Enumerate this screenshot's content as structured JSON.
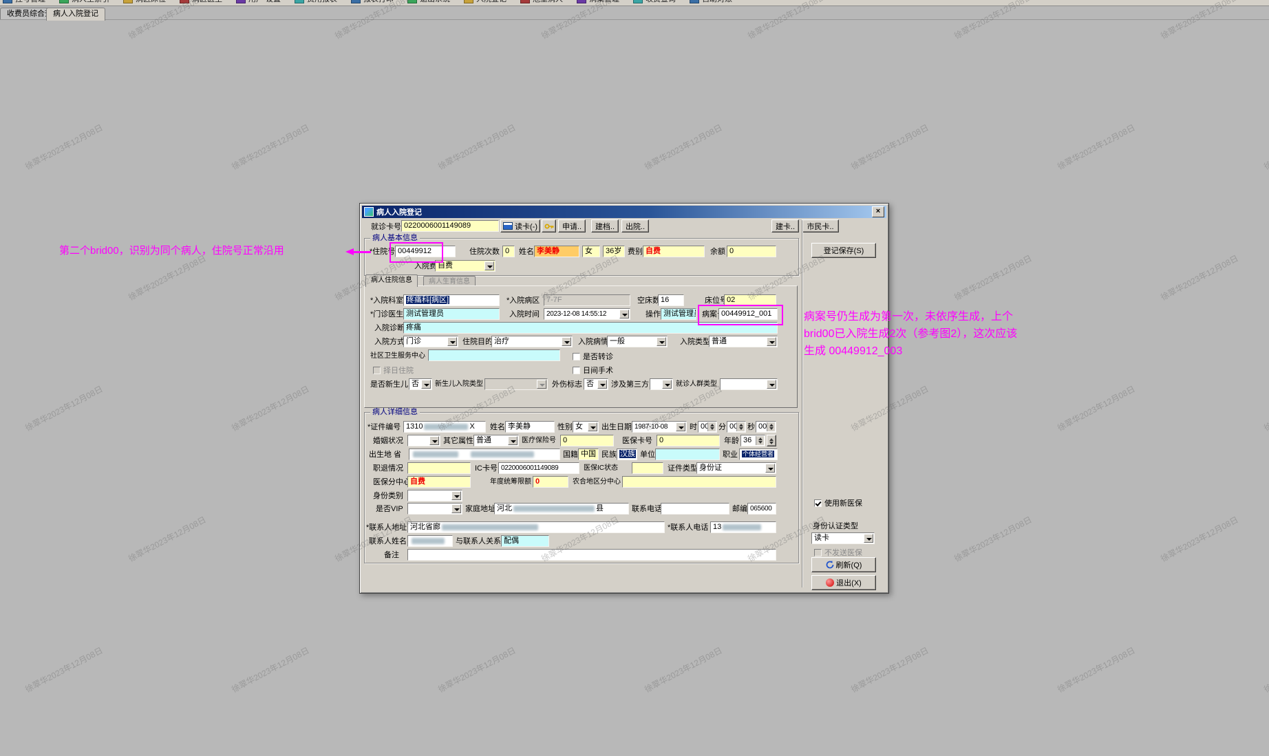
{
  "watermark": {
    "text": "徐翠华2023年12月08日"
  },
  "top_toolbar": {
    "items": [
      {
        "label": "挂号管理"
      },
      {
        "label": "病人主索引"
      },
      {
        "label": "病区床位"
      },
      {
        "label": "病区医生"
      },
      {
        "label": "用户 设置"
      },
      {
        "label": "费用报表"
      },
      {
        "label": "报表打印"
      },
      {
        "label": "退出系统"
      },
      {
        "label": "入院登记"
      },
      {
        "label": "危重病人"
      },
      {
        "label": "病案管理"
      },
      {
        "label": "收费查询"
      },
      {
        "label": "自助对账"
      }
    ]
  },
  "window_tabs": [
    {
      "label": "收费员综合查询"
    },
    {
      "label": "病人入院登记"
    }
  ],
  "annotations": {
    "left_note": "第二个brid00，识别为同个病人，住院号正常沿用",
    "right_note_line1": "病案号仍生成为第一次，未依序生成，上个",
    "right_note_line2": "brid00已入院生成2次（参考图2），这次应该",
    "right_note_line3": "生成 00449912_003"
  },
  "colors": {
    "highlight": "#ff00ff",
    "field_yellow": "#ffffc0",
    "field_cyan": "#c9fbfb",
    "name_bg": "#ffcc66",
    "alert_red": "#f00000"
  },
  "dialog": {
    "title": "病人入院登记",
    "close": "×",
    "card": {
      "label": "就诊卡号",
      "value": "0220006001149089",
      "btn_read": "读卡(-)",
      "btn_apply": "申请..",
      "btn_archive": "建档..",
      "btn_discharge": "出院..",
      "btn_makecard": "建卡..",
      "btn_citizen": "市民卡.."
    },
    "basic": {
      "group_label": "病人基本信息",
      "adm_no_label": "*住院号",
      "adm_no": "00449912",
      "times_label": "住院次数",
      "times": "0",
      "name_label": "姓名",
      "name": "李美静",
      "gender": "女",
      "age": "36岁",
      "fee_label": "费别",
      "fee": "自费",
      "balance_label": "余额",
      "balance": "0",
      "adm_fee_label": "入院费别",
      "adm_fee": "自费"
    },
    "info_tabs": {
      "t1": "病人住院信息",
      "t2": "病人生育信息"
    },
    "adm": {
      "dept_label": "*入院科室",
      "dept": "疼痛科[病区]",
      "ward_label": "*入院病区",
      "ward": "7-7F",
      "beds_label": "空床数",
      "beds": "16",
      "bed_label": "床位号",
      "bed": "02",
      "doctor_label": "*门诊医生",
      "doctor": "测试管理员",
      "time_label": "入院时间",
      "time": "2023-12-08 14:55:12",
      "op_label": "操作员",
      "op": "测试管理员",
      "case_label": "病案号",
      "case_no": "00449912_001",
      "diag_label": "入院诊断",
      "diag": "疼痛",
      "mode_label": "入院方式",
      "mode": "门诊",
      "purpose_label": "住院目的",
      "purpose": "治疗",
      "cond_label": "入院病情",
      "cond": "一般",
      "type_label": "入院类型",
      "type": "普通",
      "community_label": "社区卫生服务中心",
      "transfer_label": "是否转诊",
      "schedule_label": "择日住院",
      "daysurgery_label": "日间手术",
      "newborn_label": "是否新生儿",
      "newborn": "否",
      "newborn_type_label": "新生儿入院类型",
      "trauma_label": "外伤标志",
      "trauma": "否",
      "third_label": "涉及第三方",
      "crowd_label": "就诊人群类型"
    },
    "detail": {
      "group_label": "病人详细信息",
      "cert_label": "*证件编号",
      "cert_prefix": "1310",
      "cert_suffix": "X",
      "name_label": "姓名",
      "name": "李美静",
      "gender_label": "性别",
      "gender": "女",
      "birth_label": "出生日期",
      "birth": "1987-10-08",
      "hour_label": "时",
      "hour": "00",
      "min_label": "分",
      "min": "00",
      "sec_label": "秒",
      "sec": "00",
      "marital_label": "婚姻状况",
      "attr_label": "其它属性",
      "attr": "普通",
      "insno_label": "医疗保险号",
      "insno": "0",
      "inscard_label": "医保卡号",
      "inscard": "0",
      "age_label": "年龄",
      "age": "36",
      "birthplace_label": "出生地 省",
      "nation_label": "国籍",
      "nation": "中国",
      "ethnic_label": "民族",
      "ethnic": "汉族",
      "unit_label": "单位",
      "occ_label": "职业",
      "occ": "个体经营者",
      "employ_label": "职退情况",
      "ic_label": "IC卡号",
      "ic": "0220006001149089",
      "icstat_label": "医保IC状态",
      "certtype_label": "证件类型",
      "certtype": "身份证",
      "center_label": "医保分中心",
      "center": "自费",
      "limit_label": "年度统筹限额",
      "limit": "0",
      "rural_label": "农合地区分中心",
      "idclass_label": "身份类别",
      "vip_label": "是否VIP",
      "home_label": "家庭地址",
      "home_prefix": "河北",
      "home_suffix": "县",
      "phone_label": "联系电话",
      "zip_label": "邮编",
      "zip": "065600",
      "caddr_label": "*联系人地址",
      "caddr_prefix": "河北省廊",
      "cphone_label": "*联系人电话",
      "cphone_prefix": "13",
      "cname_label": "联系人姓名",
      "crel_label": "与联系人关系",
      "crel": "配偶",
      "remark_label": "备注"
    },
    "side": {
      "save": "登记保存(S)",
      "use_new": "使用新医保",
      "auth_label": "身份认证类型",
      "auth_value": "读卡",
      "no_send": "不发送医保",
      "refresh": "刷新(Q)",
      "exit": "退出(X)"
    }
  }
}
